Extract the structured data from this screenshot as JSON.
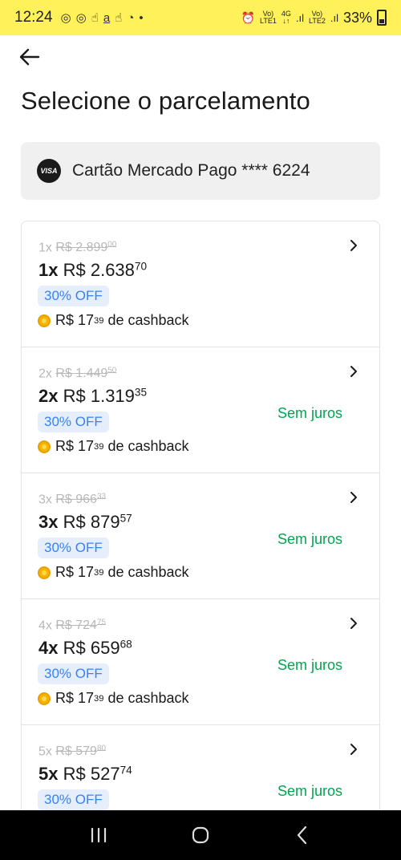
{
  "status_bar": {
    "time": "12:24",
    "battery": "33%",
    "sim1": "LTE1",
    "sim2": "LTE2",
    "network": "4G"
  },
  "header": {
    "title": "Selecione o parcelamento"
  },
  "payment_card": {
    "brand": "VISA",
    "label": "Cartão Mercado Pago **** 6224"
  },
  "installments": [
    {
      "qty": "1x",
      "orig_prefix": "1x",
      "orig_int": "R$ 2.899",
      "orig_cents": "00",
      "price_int": "R$ 2.638",
      "price_cents": "70",
      "badge": "30% OFF",
      "cashback_int": "R$ 17",
      "cashback_cents": "39",
      "cashback_suffix": "de cashback",
      "tag": ""
    },
    {
      "qty": "2x",
      "orig_prefix": "2x",
      "orig_int": "R$ 1.449",
      "orig_cents": "50",
      "price_int": "R$ 1.319",
      "price_cents": "35",
      "badge": "30% OFF",
      "cashback_int": "R$ 17",
      "cashback_cents": "39",
      "cashback_suffix": "de cashback",
      "tag": "Sem juros"
    },
    {
      "qty": "3x",
      "orig_prefix": "3x",
      "orig_int": "R$ 966",
      "orig_cents": "33",
      "price_int": "R$ 879",
      "price_cents": "57",
      "badge": "30% OFF",
      "cashback_int": "R$ 17",
      "cashback_cents": "39",
      "cashback_suffix": "de cashback",
      "tag": "Sem juros"
    },
    {
      "qty": "4x",
      "orig_prefix": "4x",
      "orig_int": "R$ 724",
      "orig_cents": "75",
      "price_int": "R$ 659",
      "price_cents": "68",
      "badge": "30% OFF",
      "cashback_int": "R$ 17",
      "cashback_cents": "39",
      "cashback_suffix": "de cashback",
      "tag": "Sem juros"
    },
    {
      "qty": "5x",
      "orig_prefix": "5x",
      "orig_int": "R$ 579",
      "orig_cents": "80",
      "price_int": "R$ 527",
      "price_cents": "74",
      "badge": "30% OFF",
      "cashback_int": "",
      "cashback_cents": "",
      "cashback_suffix": "",
      "tag": "Sem juros"
    }
  ],
  "colors": {
    "status_bar_bg": "#fff159",
    "badge_text": "#3483fa",
    "badge_bg": "#e6eefb",
    "sem_juros": "#00a650"
  }
}
